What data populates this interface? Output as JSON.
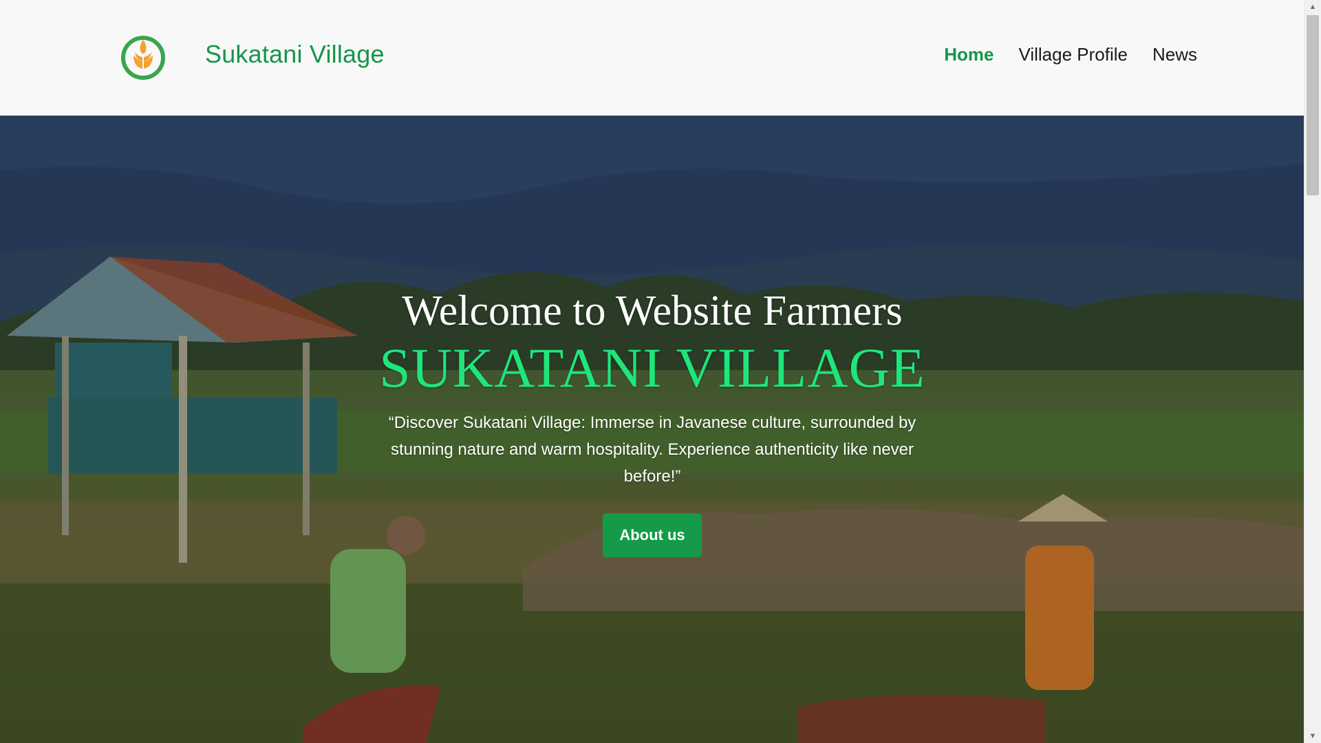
{
  "header": {
    "brand": "Sukatani Village",
    "nav": [
      {
        "label": "Home",
        "active": true
      },
      {
        "label": "Village Profile",
        "active": false
      },
      {
        "label": "News",
        "active": false
      }
    ]
  },
  "hero": {
    "title": "Welcome to Website Farmers",
    "village": "SUKATANI VILLAGE",
    "description": "“Discover Sukatani Village: Immerse in Javanese culture, surrounded by stunning nature and warm hospitality. Experience authenticity like never before!”",
    "button_label": "About us"
  },
  "colors": {
    "brand_green": "#15954a",
    "accent_green": "#1ee67c",
    "button_green": "#149a48"
  },
  "icons": {
    "logo": "wheat-leaf-logo-icon",
    "scroll_up": "arrow-up-icon",
    "scroll_down": "arrow-down-icon"
  }
}
